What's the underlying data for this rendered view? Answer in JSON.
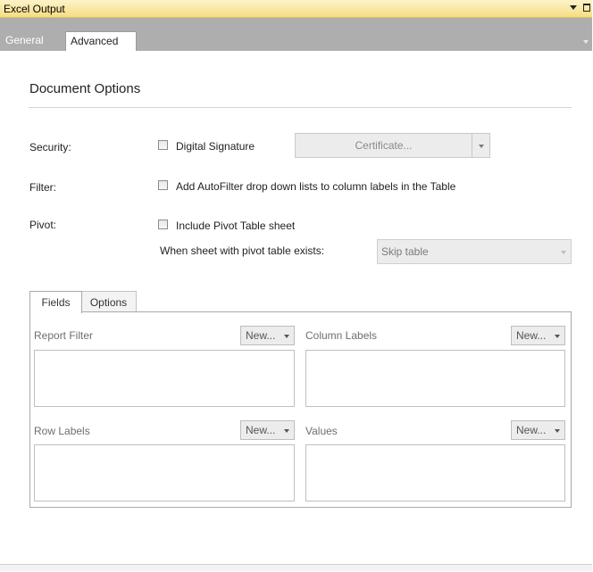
{
  "window": {
    "title": "Excel Output"
  },
  "tabs": [
    {
      "label": "General"
    },
    {
      "label": "Advanced"
    }
  ],
  "document_options": {
    "heading": "Document Options",
    "security": {
      "label": "Security:",
      "checkbox_label": "Digital Signature",
      "checked": false,
      "certificate_button": "Certificate..."
    },
    "filter": {
      "label": "Filter:",
      "checkbox_label": "Add AutoFilter drop down lists to column labels in the Table",
      "checked": false
    },
    "pivot": {
      "label": "Pivot:",
      "checkbox_label": "Include Pivot Table sheet",
      "checked": false,
      "exists_label": "When sheet with pivot table exists:",
      "exists_value": "Skip table"
    }
  },
  "pivot_tabs": [
    {
      "label": "Fields"
    },
    {
      "label": "Options"
    }
  ],
  "areas": {
    "report_filter": {
      "label": "Report Filter",
      "new_button": "New..."
    },
    "column_labels": {
      "label": "Column Labels",
      "new_button": "New..."
    },
    "row_labels": {
      "label": "Row Labels",
      "new_button": "New..."
    },
    "values": {
      "label": "Values",
      "new_button": "New..."
    }
  },
  "icons": {
    "window_menu": "chevron-down-icon",
    "window_maximize": "maximize-icon",
    "dropdown": "dropdown-arrow-icon"
  },
  "colors": {
    "titlebar": "#f6dd84",
    "tabstrip": "#aeaeae",
    "border": "#a9a9a9"
  }
}
